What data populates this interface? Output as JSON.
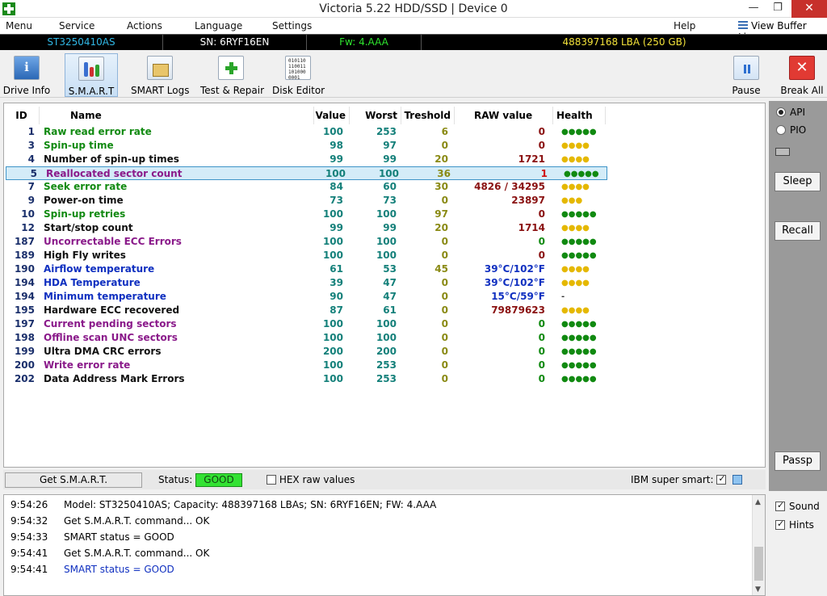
{
  "window": {
    "title": "Victoria 5.22 HDD/SSD | Device 0",
    "min_glyph": "—",
    "max_glyph": "❐",
    "close_glyph": "✕"
  },
  "menu": {
    "items": [
      "Menu",
      "Service",
      "Actions",
      "Language",
      "Settings"
    ],
    "help": "Help",
    "view_buffer": "View Buffer Live"
  },
  "device": {
    "model": "ST3250410AS",
    "serial": "SN: 6RYF16EN",
    "firmware": "Fw: 4.AAA",
    "capacity": "488397168 LBA (250 GB)",
    "colors": {
      "model": "#31b8e6",
      "serial": "#ffffff",
      "firmware": "#2ee62e",
      "capacity": "#f3e23a"
    }
  },
  "toolbar": {
    "drive_info": "Drive Info",
    "smart": "S.M.A.R.T",
    "smart_logs": "SMART Logs",
    "test_repair": "Test & Repair",
    "disk_editor": "Disk Editor",
    "disk_editor_icon_text": "010110\n110011\n101000\n0001",
    "pause": "Pause",
    "break_all": "Break All"
  },
  "table": {
    "headers": {
      "id": "ID",
      "name": "Name",
      "value": "Value",
      "worst": "Worst",
      "threshold": "Treshold",
      "raw": "RAW value",
      "health": "Health"
    },
    "rows": [
      {
        "id": "1",
        "name": "Raw read error rate",
        "value": "100",
        "worst": "253",
        "thr": "6",
        "raw": "0",
        "health": "●●●●●",
        "name_color": "#118a11",
        "health_color": "#118a11"
      },
      {
        "id": "3",
        "name": "Spin-up time",
        "value": "98",
        "worst": "97",
        "thr": "0",
        "raw": "0",
        "health": "●●●●",
        "name_color": "#118a11",
        "health_color": "#e5b800"
      },
      {
        "id": "4",
        "name": "Number of spin-up times",
        "value": "99",
        "worst": "99",
        "thr": "20",
        "raw": "1721",
        "health": "●●●●",
        "name_color": "#111111",
        "health_color": "#e5b800"
      },
      {
        "id": "5",
        "name": "Reallocated sector count",
        "value": "100",
        "worst": "100",
        "thr": "36",
        "raw": "1",
        "health": "●●●●●",
        "name_color": "#8a1a8a",
        "health_color": "#118a11",
        "raw_color": "#d01010",
        "selected": true
      },
      {
        "id": "7",
        "name": "Seek error rate",
        "value": "84",
        "worst": "60",
        "thr": "30",
        "raw": "4826 / 34295",
        "health": "●●●●",
        "name_color": "#118a11",
        "health_color": "#e5b800"
      },
      {
        "id": "9",
        "name": "Power-on time",
        "value": "73",
        "worst": "73",
        "thr": "0",
        "raw": "23897",
        "health": "●●●",
        "name_color": "#111111",
        "health_color": "#e5b800"
      },
      {
        "id": "10",
        "name": "Spin-up retries",
        "value": "100",
        "worst": "100",
        "thr": "97",
        "raw": "0",
        "health": "●●●●●",
        "name_color": "#118a11",
        "health_color": "#118a11"
      },
      {
        "id": "12",
        "name": "Start/stop count",
        "value": "99",
        "worst": "99",
        "thr": "20",
        "raw": "1714",
        "health": "●●●●",
        "name_color": "#111111",
        "health_color": "#e5b800"
      },
      {
        "id": "187",
        "name": "Uncorrectable ECC Errors",
        "value": "100",
        "worst": "100",
        "thr": "0",
        "raw": "0",
        "health": "●●●●●",
        "name_color": "#8a1a8a",
        "health_color": "#118a11",
        "raw_color": "#118a11"
      },
      {
        "id": "189",
        "name": "High Fly writes",
        "value": "100",
        "worst": "100",
        "thr": "0",
        "raw": "0",
        "health": "●●●●●",
        "name_color": "#111111",
        "health_color": "#118a11"
      },
      {
        "id": "190",
        "name": "Airflow temperature",
        "value": "61",
        "worst": "53",
        "thr": "45",
        "raw": "39°C/102°F",
        "health": "●●●●",
        "name_color": "#1030c0",
        "health_color": "#e5b800",
        "raw_color": "#1030c0"
      },
      {
        "id": "194",
        "name": "HDA Temperature",
        "value": "39",
        "worst": "47",
        "thr": "0",
        "raw": "39°C/102°F",
        "health": "●●●●",
        "name_color": "#1030c0",
        "health_color": "#e5b800",
        "raw_color": "#1030c0"
      },
      {
        "id": "194",
        "name": "Minimum temperature",
        "value": "90",
        "worst": "47",
        "thr": "0",
        "raw": "15°C/59°F",
        "health": "-",
        "name_color": "#1030c0",
        "health_color": "#333333",
        "raw_color": "#1030c0"
      },
      {
        "id": "195",
        "name": "Hardware ECC recovered",
        "value": "87",
        "worst": "61",
        "thr": "0",
        "raw": "79879623",
        "health": "●●●●",
        "name_color": "#111111",
        "health_color": "#e5b800"
      },
      {
        "id": "197",
        "name": "Current pending sectors",
        "value": "100",
        "worst": "100",
        "thr": "0",
        "raw": "0",
        "health": "●●●●●",
        "name_color": "#8a1a8a",
        "health_color": "#118a11",
        "raw_color": "#118a11"
      },
      {
        "id": "198",
        "name": "Offline scan UNC sectors",
        "value": "100",
        "worst": "100",
        "thr": "0",
        "raw": "0",
        "health": "●●●●●",
        "name_color": "#8a1a8a",
        "health_color": "#118a11",
        "raw_color": "#118a11"
      },
      {
        "id": "199",
        "name": "Ultra DMA CRC errors",
        "value": "200",
        "worst": "200",
        "thr": "0",
        "raw": "0",
        "health": "●●●●●",
        "name_color": "#111111",
        "health_color": "#118a11",
        "raw_color": "#118a11"
      },
      {
        "id": "200",
        "name": "Write error rate",
        "value": "100",
        "worst": "253",
        "thr": "0",
        "raw": "0",
        "health": "●●●●●",
        "name_color": "#8a1a8a",
        "health_color": "#118a11",
        "raw_color": "#118a11"
      },
      {
        "id": "202",
        "name": "Data Address Mark Errors",
        "value": "100",
        "worst": "253",
        "thr": "0",
        "raw": "0",
        "health": "●●●●●",
        "name_color": "#111111",
        "health_color": "#118a11",
        "raw_color": "#118a11"
      }
    ]
  },
  "side": {
    "api": "API",
    "pio": "PIO",
    "sleep": "Sleep",
    "recall": "Recall",
    "passp": "Passp"
  },
  "status": {
    "get_smart": "Get S.M.A.R.T.",
    "label": "Status:",
    "value": "GOOD",
    "hex_raw": "HEX raw values",
    "ibm": "IBM super smart:"
  },
  "log": [
    {
      "time": "9:54:26",
      "msg": "Model: ST3250410AS; Capacity: 488397168 LBAs; SN: 6RYF16EN; FW: 4.AAA"
    },
    {
      "time": "9:54:32",
      "msg": "Get S.M.A.R.T. command... OK"
    },
    {
      "time": "9:54:33",
      "msg": "SMART status = GOOD"
    },
    {
      "time": "9:54:41",
      "msg": "Get S.M.A.R.T. command... OK"
    },
    {
      "time": "9:54:41",
      "msg": "SMART status = GOOD",
      "blue": true
    }
  ],
  "bottom_side": {
    "sound": "Sound",
    "hints": "Hints"
  }
}
